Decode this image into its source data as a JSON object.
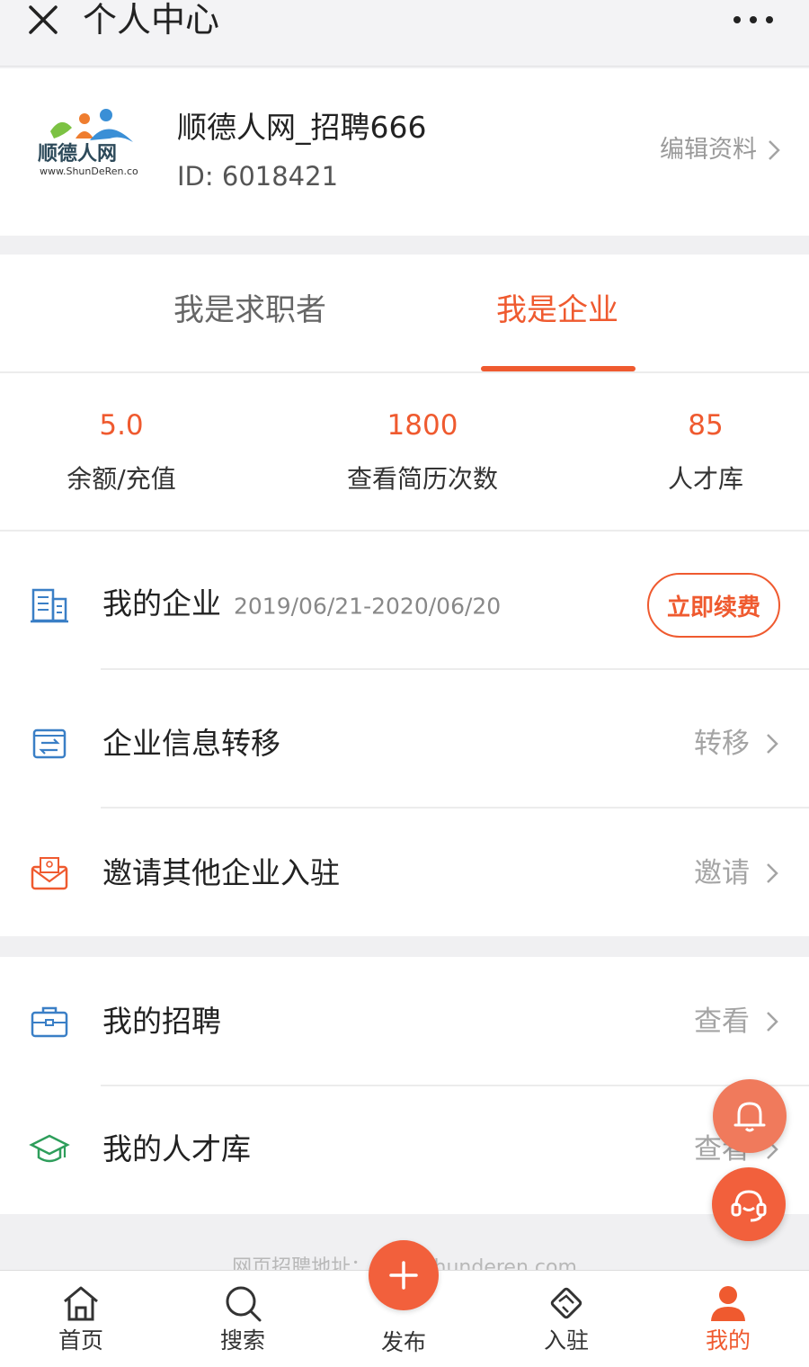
{
  "header": {
    "title": "个人中心"
  },
  "profile": {
    "name": "顺德人网_招聘666",
    "id_text": "ID: 6018421",
    "edit_label": "编辑资料",
    "logo_text": "顺德人网",
    "logo_url_text": "www.ShunDeRen.co"
  },
  "tabs": [
    {
      "label": "我是求职者",
      "active": false
    },
    {
      "label": "我是企业",
      "active": true
    }
  ],
  "stats": [
    {
      "value": "5.0",
      "label": "余额/充值"
    },
    {
      "value": "1800",
      "label": "查看简历次数"
    },
    {
      "value": "85",
      "label": "人才库"
    }
  ],
  "rows": [
    {
      "label": "我的企业",
      "sub": "2019/06/21-2020/06/20",
      "action": "立即续费"
    },
    {
      "label": "企业信息转移",
      "action": "转移"
    },
    {
      "label": "邀请其他企业入驻",
      "action": "邀请"
    },
    {
      "label": "我的招聘",
      "action": "查看"
    },
    {
      "label": "我的人才库",
      "action": "查看"
    }
  ],
  "footer": {
    "note": "网页招聘地址：www.shunderen.com"
  },
  "nav": [
    {
      "label": "首页",
      "icon": "home-icon"
    },
    {
      "label": "搜索",
      "icon": "search-icon"
    },
    {
      "label": "发布",
      "icon": "plus-icon"
    },
    {
      "label": "入驻",
      "icon": "handshake-icon"
    },
    {
      "label": "我的",
      "icon": "user-icon",
      "active": true
    }
  ],
  "colors": {
    "accent": "#ef5a2f",
    "blue_icon": "#3a7fc6",
    "green_icon": "#2e9e5b"
  }
}
